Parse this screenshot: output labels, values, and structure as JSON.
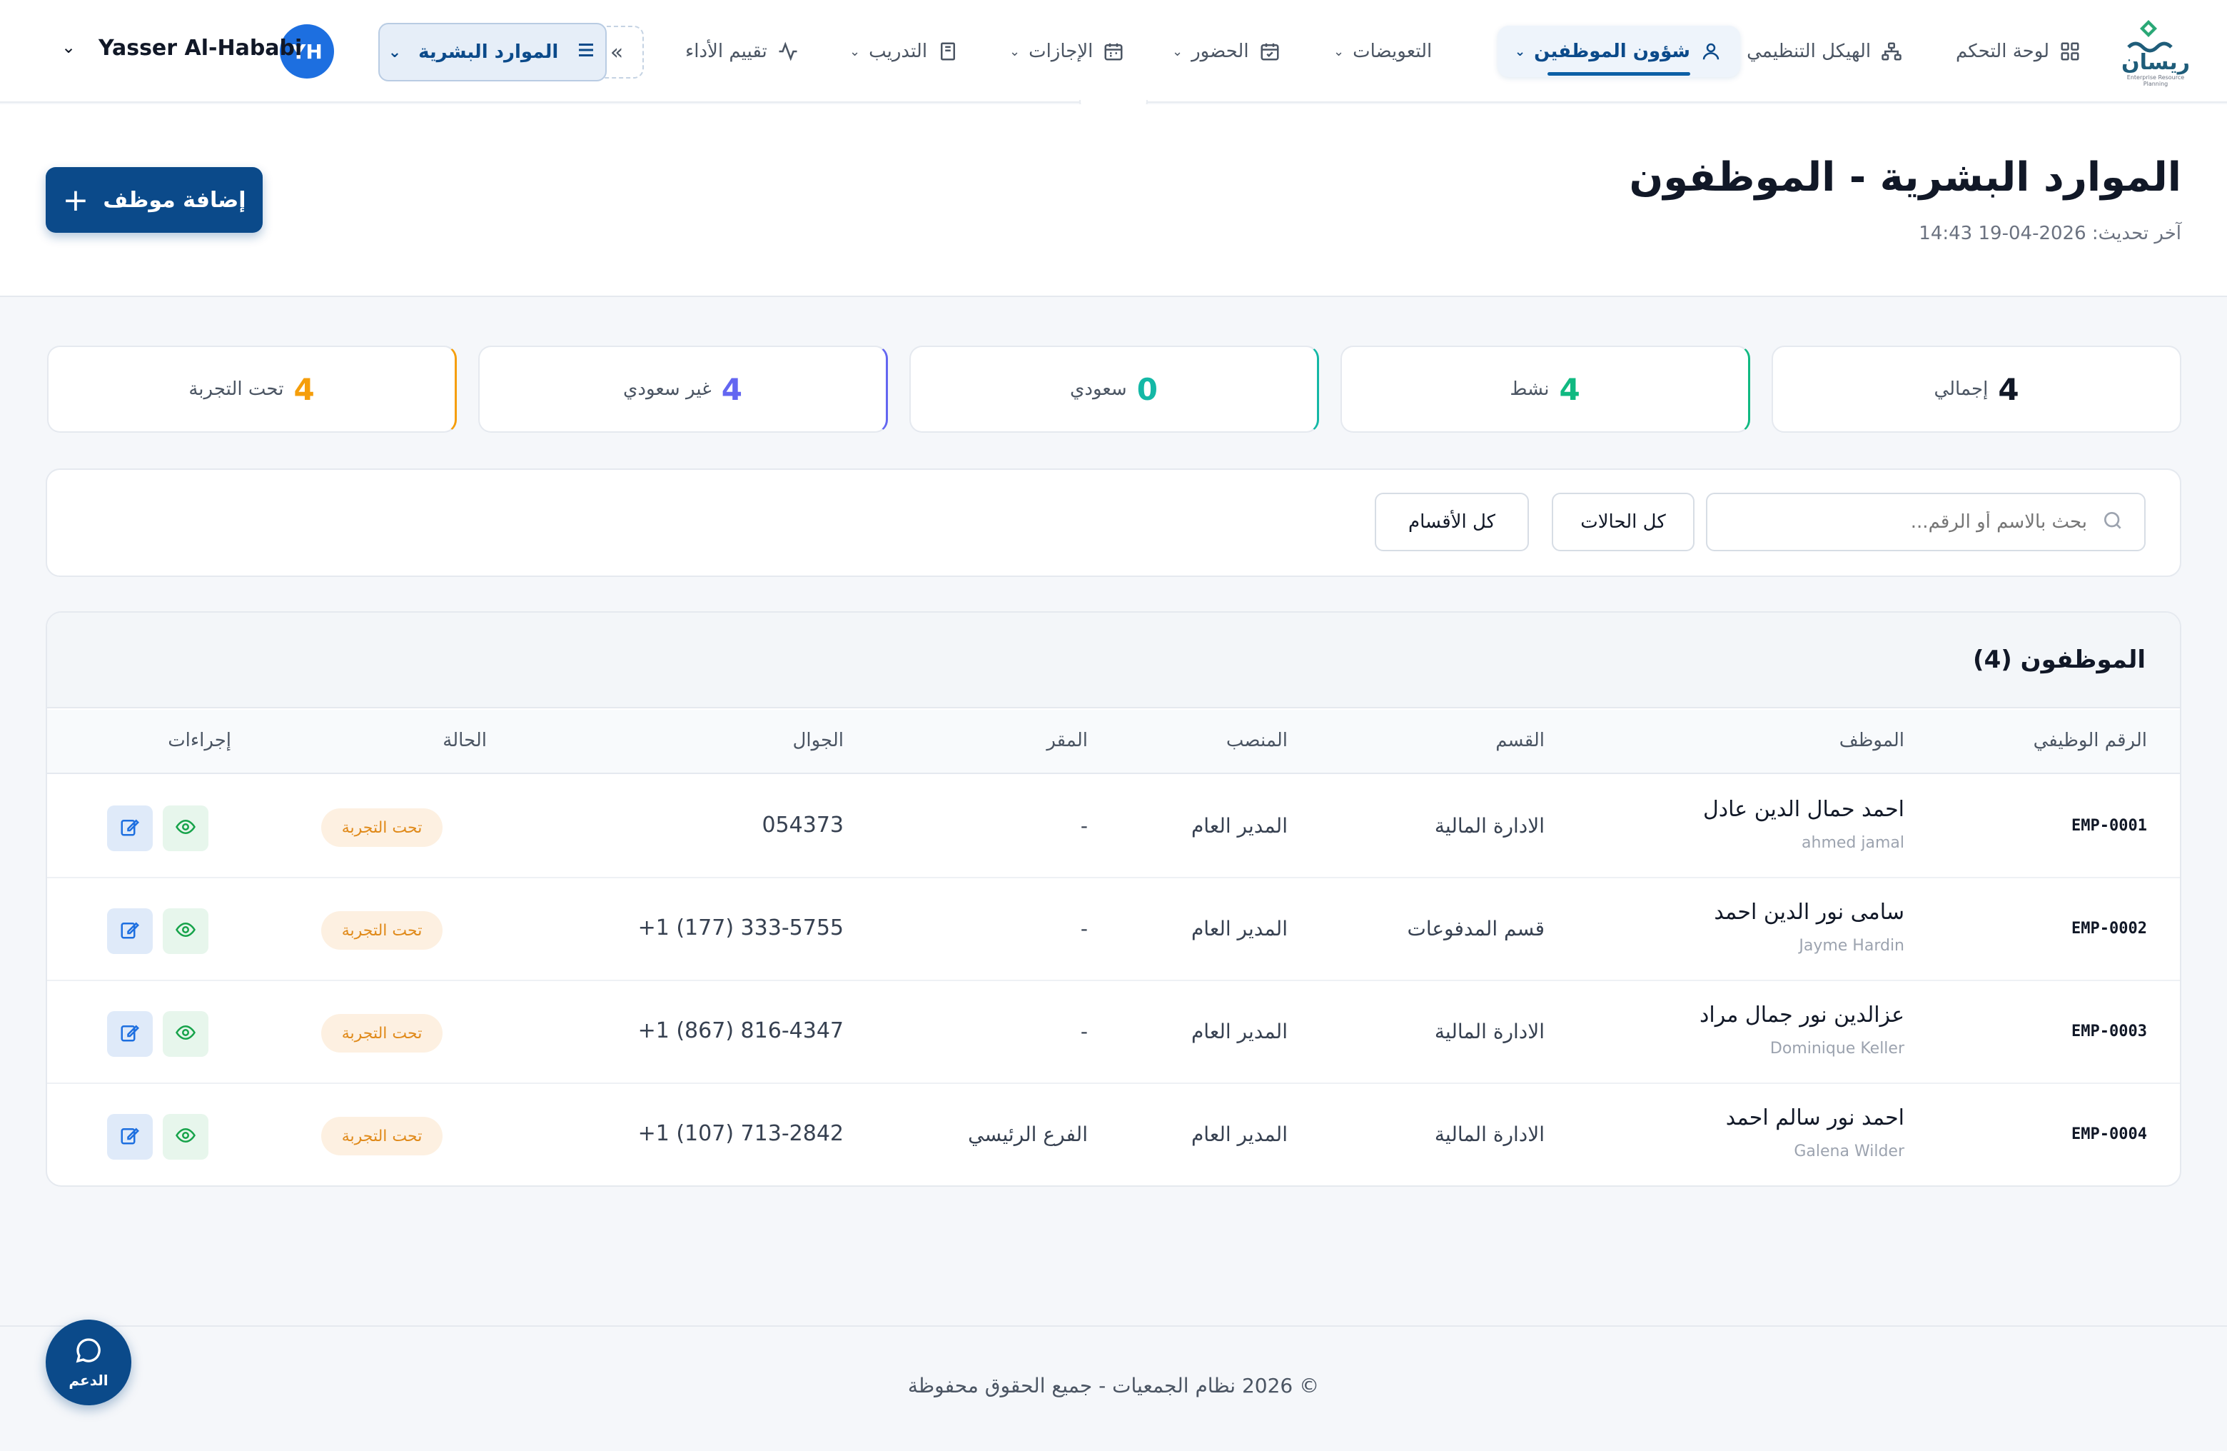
{
  "nav": {
    "logo_text": "ريسان",
    "logo_subtitle": "Enterprise Resource Planning",
    "items": [
      {
        "label": "لوحة التحكم",
        "icon": "grid-icon"
      },
      {
        "label": "الهيكل التنظيمي",
        "icon": "org-chart-icon"
      },
      {
        "label": "شؤون الموظفين",
        "icon": "user-icon",
        "active": true
      },
      {
        "label": "التعويضات"
      },
      {
        "label": "الحضور",
        "icon": "calendar-check-icon"
      },
      {
        "label": "الإجازات",
        "icon": "calendar-icon"
      },
      {
        "label": "التدريب",
        "icon": "book-icon"
      },
      {
        "label": "تقييم الأداء",
        "icon": "activity-icon"
      }
    ],
    "module_selector": "الموارد البشرية",
    "user": {
      "initials": "YH",
      "name": "Yasser Al-Hababi"
    }
  },
  "header": {
    "title": "الموارد البشرية - الموظفون",
    "last_update": "آخر تحديث: 2026-04-19 14:43",
    "add_button": "إضافة موظف"
  },
  "stats": [
    {
      "value": "4",
      "label": "إجمالي",
      "color": "#111827"
    },
    {
      "value": "4",
      "label": "نشط",
      "color": "#10b981"
    },
    {
      "value": "0",
      "label": "سعودي",
      "color": "#14b8a6"
    },
    {
      "value": "4",
      "label": "غير سعودي",
      "color": "#6366f1"
    },
    {
      "value": "4",
      "label": "تحت التجربة",
      "color": "#f59e0b"
    }
  ],
  "filters": {
    "search_placeholder": "بحث بالاسم أو الرقم...",
    "status_select": "كل الحالات",
    "department_select": "كل الأقسام"
  },
  "table": {
    "title": "الموظفون (4)",
    "columns": {
      "id": "الرقم الوظيفي",
      "employee": "الموظف",
      "department": "القسم",
      "position": "المنصب",
      "branch": "المقر",
      "mobile": "الجوال",
      "status": "الحالة",
      "actions": "إجراءات"
    },
    "rows": [
      {
        "id": "EMP-0001",
        "name": "احمد حمال الدين عادل",
        "sub": "ahmed jamal",
        "department": "الادارة المالية",
        "position": "المدير العام",
        "branch": "-",
        "mobile": "054373",
        "status": "تحت التجربة"
      },
      {
        "id": "EMP-0002",
        "name": "سامى نور الدين احمد",
        "sub": "Jayme Hardin",
        "department": "قسم المدفوعات",
        "position": "المدير العام",
        "branch": "-",
        "mobile": "+1 (177) 333-5755",
        "status": "تحت التجربة"
      },
      {
        "id": "EMP-0003",
        "name": "عزالدين نور جمال مراد",
        "sub": "Dominique Keller",
        "department": "الادارة المالية",
        "position": "المدير العام",
        "branch": "-",
        "mobile": "+1 (867) 816-4347",
        "status": "تحت التجربة"
      },
      {
        "id": "EMP-0004",
        "name": "احمد نور سالم احمد",
        "sub": "Galena Wilder",
        "department": "الادارة المالية",
        "position": "المدير العام",
        "branch": "الفرع الرئيسي",
        "mobile": "+1 (107) 713-2842",
        "status": "تحت التجربة"
      }
    ]
  },
  "footer": {
    "copyright": "© 2026 نظام الجمعيات - جميع الحقوق محفوظة",
    "support_label": "الدعم"
  }
}
